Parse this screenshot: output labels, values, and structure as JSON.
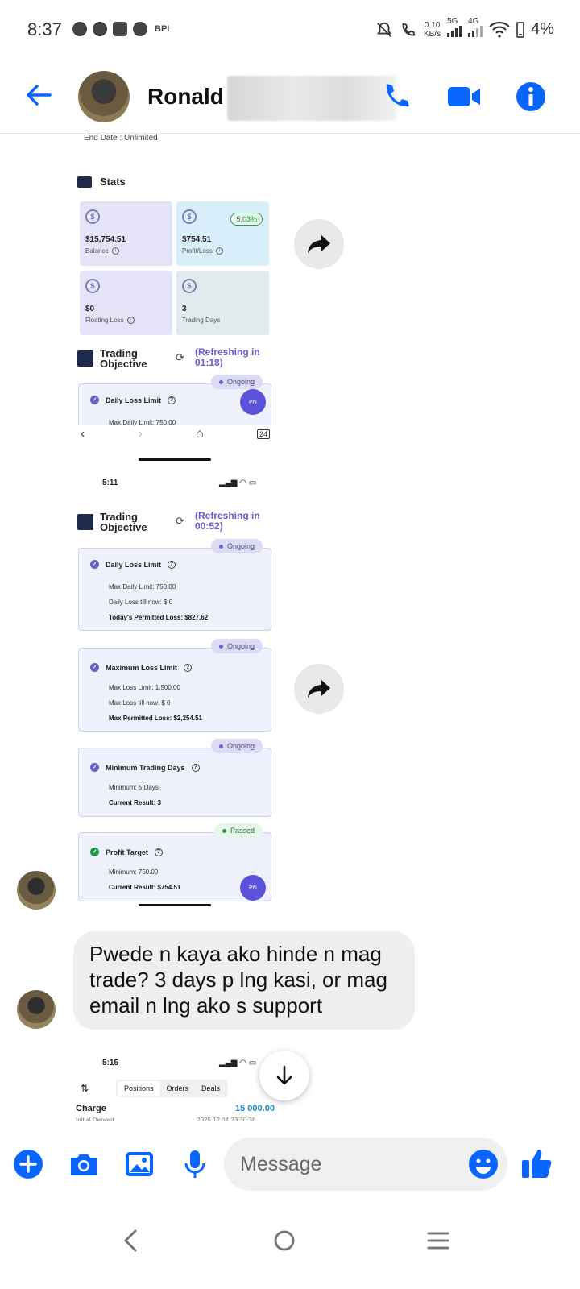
{
  "status_bar": {
    "time": "8:37",
    "carrier_tag": "BPI",
    "speed_value": "0.10",
    "speed_unit": "KB/s",
    "net_5g": "5G",
    "net_4g": "4G",
    "battery_pct": "4%"
  },
  "header": {
    "contact_name": "Ronald I",
    "accent_color": "#0866ff"
  },
  "shared_images": {
    "image1": {
      "end_date": "End Date : Unlimited",
      "stats_title": "Stats",
      "stats": [
        {
          "value": "$15,754.51",
          "label": "Balance"
        },
        {
          "value": "$754.51",
          "label": "Profit/Loss",
          "badge": "5.03%"
        },
        {
          "value": "$0",
          "label": "Floating Loss"
        },
        {
          "value": "3",
          "label": "Trading Days"
        }
      ],
      "objective_title": "Trading Objective",
      "refresh_text": "(Refreshing in 01:18)",
      "partial_card": {
        "badge": "Ongoing",
        "title": "Daily Loss Limit",
        "line1": "Max Daily Limit: 750.00"
      },
      "fab_label": "PN",
      "browser_tab_count": "24"
    },
    "image2": {
      "time": "5:11",
      "objective_title": "Trading Objective",
      "refresh_text": "(Refreshing in 00:52)",
      "cards": [
        {
          "badge": "Ongoing",
          "title": "Daily Loss Limit",
          "lines": [
            "Max Daily Limit: 750.00",
            "Daily Loss till now: $ 0"
          ],
          "bold_line": "Today's Permitted Loss: $827.62"
        },
        {
          "badge": "Ongoing",
          "title": "Maximum Loss Limit",
          "lines": [
            "Max Loss Limit: 1,500.00",
            "Max Loss till now: $ 0"
          ],
          "bold_line": "Max Permitted Loss: $2,254.51"
        },
        {
          "badge": "Ongoing",
          "title": "Minimum Trading Days",
          "lines": [
            "Minimum: 5 Days"
          ],
          "bold_line": "Current Result: 3"
        },
        {
          "badge": "Passed",
          "title": "Profit Target",
          "lines": [
            "Minimum: 750.00"
          ],
          "bold_line": "Current Result: $754.51"
        }
      ],
      "fab_label": "PN"
    },
    "image3": {
      "time": "5:15",
      "tabs": [
        "Positions",
        "Orders",
        "Deals"
      ],
      "row_label": "Charge",
      "row_value": "15 000.00",
      "sub_label": "Initial Deposit",
      "sub_value": "2025.12.04 23:30:38"
    }
  },
  "message": {
    "text": "Pwede n kaya ako hinde n mag trade? 3 days p lng kasi, or mag email n lng ako s support"
  },
  "composer": {
    "placeholder": "Message"
  }
}
